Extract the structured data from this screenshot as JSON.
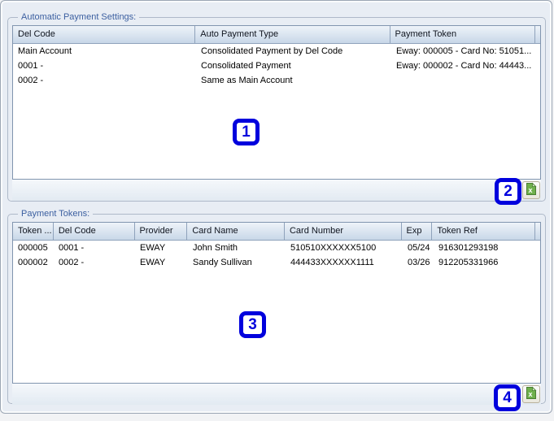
{
  "groups": [
    {
      "title": "Automatic Payment Settings:",
      "columns": [
        "Del Code",
        "Auto Payment Type",
        "Payment Token"
      ],
      "rows": [
        [
          "Main Account",
          "Consolidated Payment by Del Code",
          "Eway: 000005 - Card No: 51051..."
        ],
        [
          "0001 -",
          "Consolidated Payment",
          "Eway: 000002 - Card No: 44443..."
        ],
        [
          "0002 -",
          "Same as Main Account",
          ""
        ]
      ]
    },
    {
      "title": "Payment Tokens:",
      "columns": [
        "Token ...",
        "Del Code",
        "Provider",
        "Card Name",
        "Card Number",
        "Exp",
        "Token Ref"
      ],
      "rows": [
        [
          "000005",
          "0001 -",
          "EWAY",
          "John Smith",
          "510510XXXXXX5100",
          "05/24",
          "916301293198"
        ],
        [
          "000002",
          "0002 -",
          "EWAY",
          "Sandy Sullivan",
          "444433XXXXXX1111",
          "03/26",
          "912205331966"
        ]
      ]
    }
  ],
  "annotations": [
    "1",
    "2",
    "3",
    "4"
  ],
  "colors": {
    "group_title_blue": "#3b5fa0",
    "annotation_blue": "#0000dd",
    "excel_icon_green": "#6fb04c",
    "header_gradient_top": "#eef3f9",
    "header_gradient_bottom": "#c8d7e8",
    "window_background": "#e8edf4"
  }
}
